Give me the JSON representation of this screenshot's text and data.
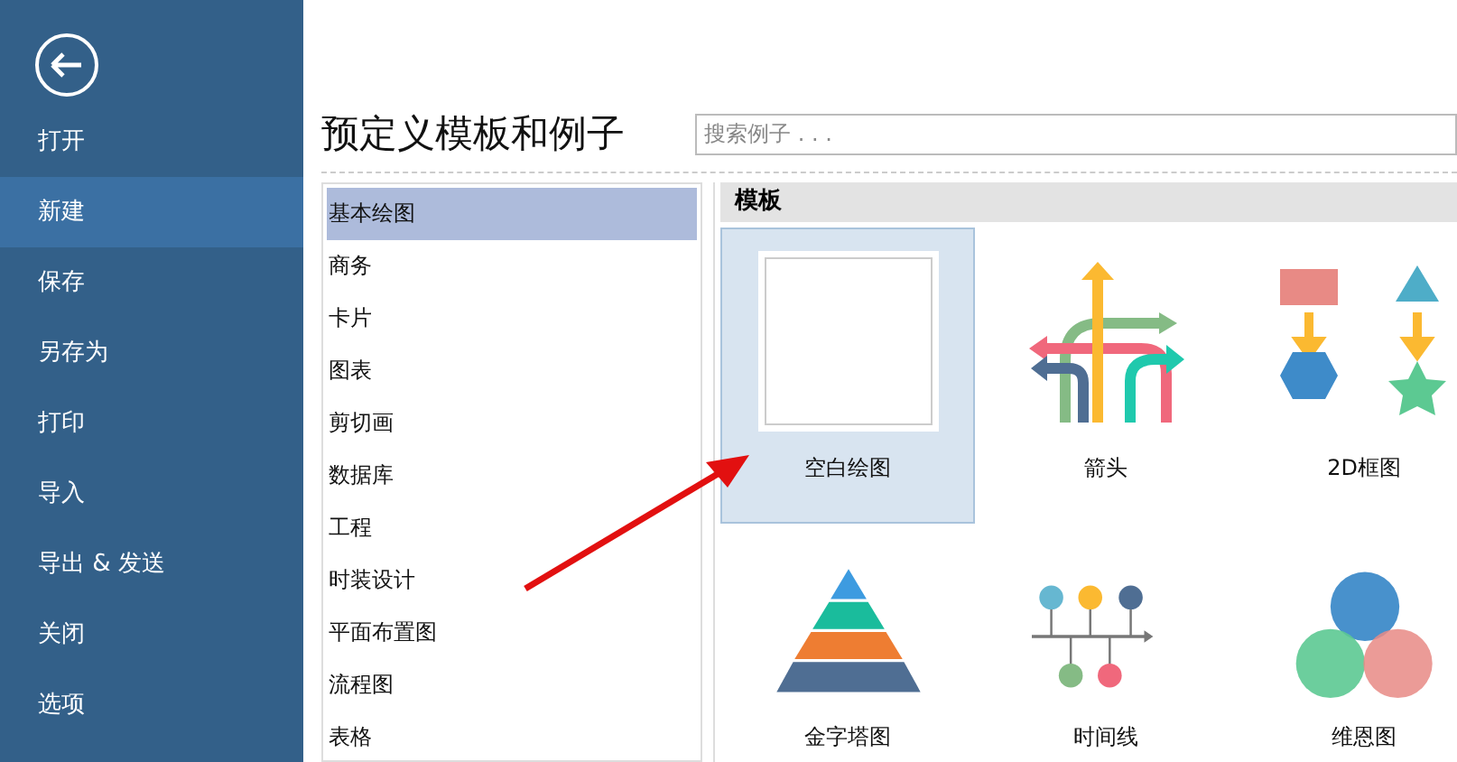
{
  "sidebar": {
    "items": [
      {
        "label": "打开",
        "selected": false
      },
      {
        "label": "新建",
        "selected": true
      },
      {
        "label": "保存",
        "selected": false
      },
      {
        "label": "另存为",
        "selected": false
      },
      {
        "label": "打印",
        "selected": false
      },
      {
        "label": "导入",
        "selected": false
      },
      {
        "label": "导出 & 发送",
        "selected": false
      },
      {
        "label": "关闭",
        "selected": false
      },
      {
        "label": "选项",
        "selected": false
      }
    ]
  },
  "title": "预定义模板和例子",
  "search": {
    "placeholder": "搜索例子 . . ."
  },
  "categories": [
    {
      "label": "基本绘图",
      "selected": true
    },
    {
      "label": "商务",
      "selected": false
    },
    {
      "label": "卡片",
      "selected": false
    },
    {
      "label": "图表",
      "selected": false
    },
    {
      "label": "剪切画",
      "selected": false
    },
    {
      "label": "数据库",
      "selected": false
    },
    {
      "label": "工程",
      "selected": false
    },
    {
      "label": "时装设计",
      "selected": false
    },
    {
      "label": "平面布置图",
      "selected": false
    },
    {
      "label": "流程图",
      "selected": false
    },
    {
      "label": "表格",
      "selected": false
    }
  ],
  "templates": {
    "header": "模板",
    "items": [
      {
        "kind": "blank",
        "label": "空白绘图",
        "selected": true
      },
      {
        "kind": "arrows",
        "label": "箭头",
        "selected": false
      },
      {
        "kind": "block2d",
        "label": "2D框图",
        "selected": false
      },
      {
        "kind": "pyramid",
        "label": "金字塔图",
        "selected": false
      },
      {
        "kind": "timeline",
        "label": "时间线",
        "selected": false
      },
      {
        "kind": "venn",
        "label": "维恩图",
        "selected": false
      }
    ]
  }
}
